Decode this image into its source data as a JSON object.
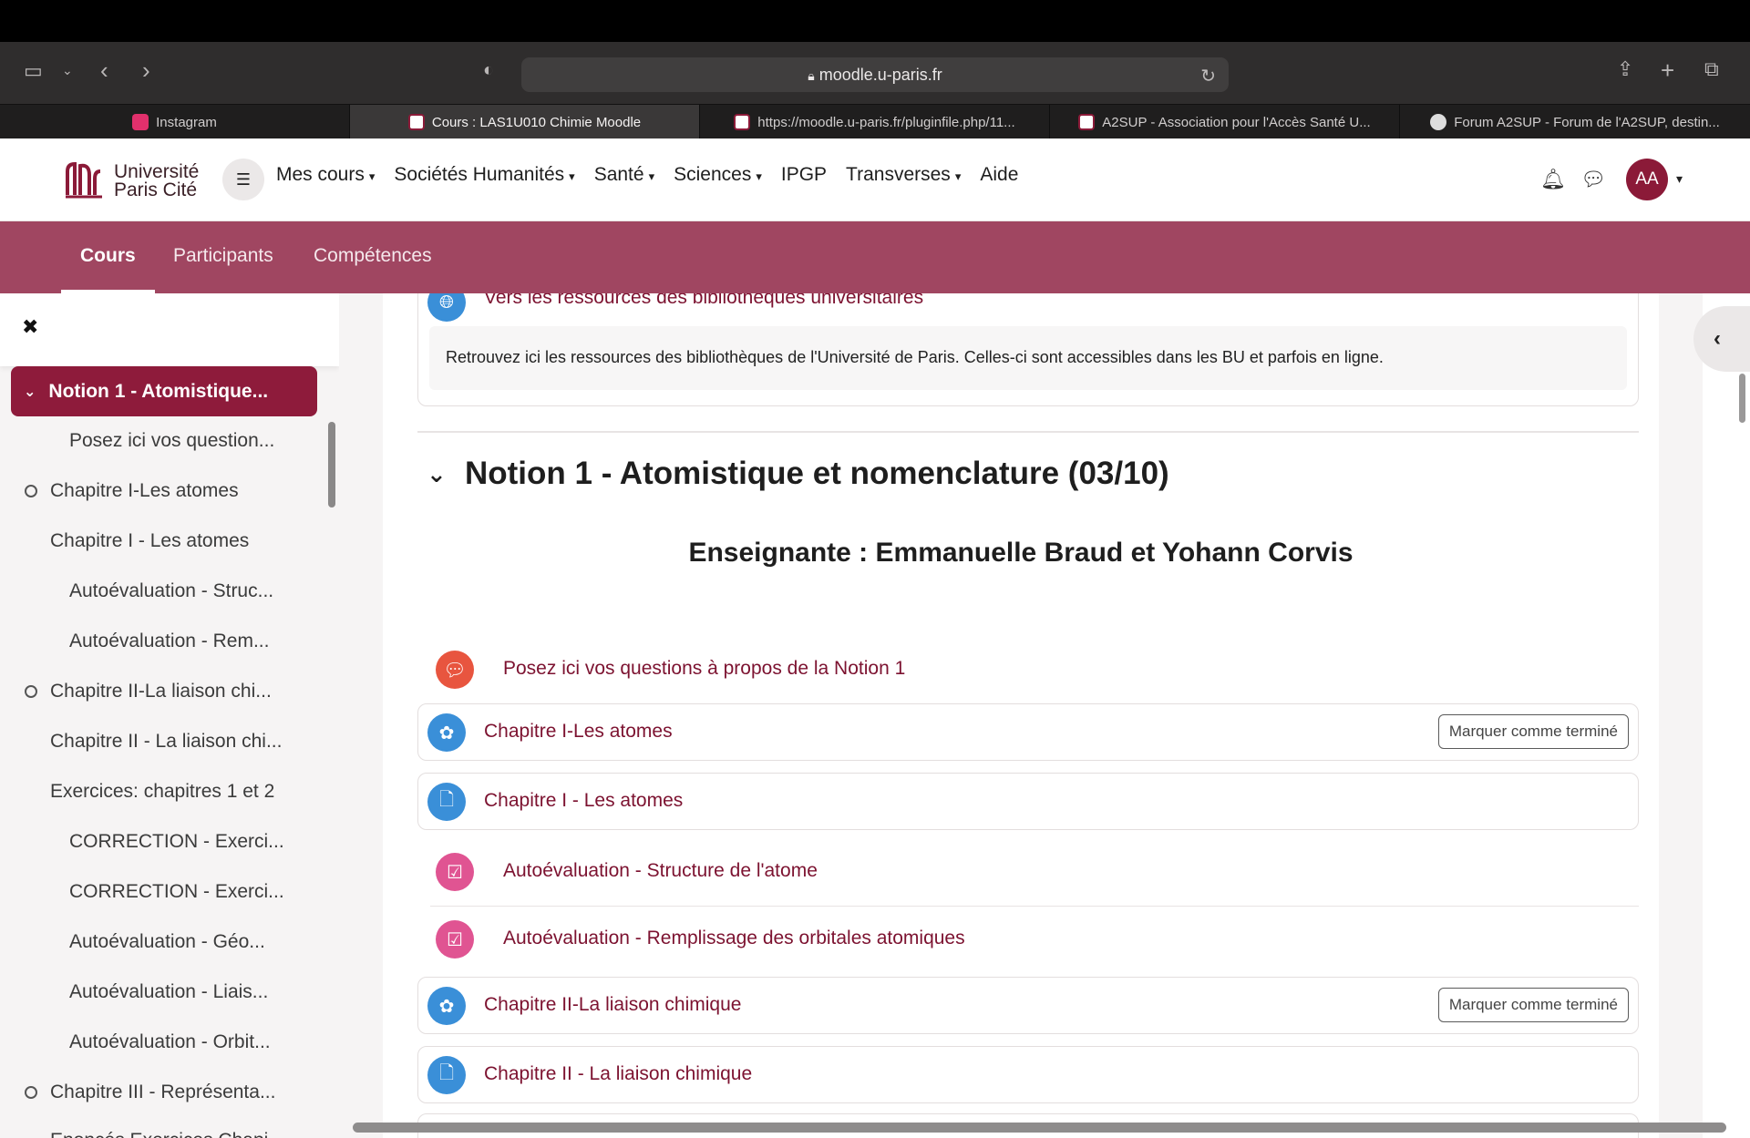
{
  "browser": {
    "address": "moodle.u-paris.fr",
    "tabs": [
      {
        "label": "Instagram",
        "color": "#e1306c"
      },
      {
        "label": "Cours : LAS1U010 Chimie Moodle",
        "color": "#8b1a38"
      },
      {
        "label": "https://moodle.u-paris.fr/pluginfile.php/11...",
        "color": "#8b1a38"
      },
      {
        "label": "A2SUP - Association pour l'Accès Santé U...",
        "color": "#8b1a38"
      },
      {
        "label": "Forum A2SUP - Forum de l'A2SUP, destin...",
        "color": "#888888"
      }
    ]
  },
  "header": {
    "logo_line1": "Université",
    "logo_line2": "Paris Cité",
    "nav": [
      {
        "label": "Mes cours",
        "dropdown": true
      },
      {
        "label": "Sociétés Humanités",
        "dropdown": true
      },
      {
        "label": "Santé",
        "dropdown": true
      },
      {
        "label": "Sciences",
        "dropdown": true
      },
      {
        "label": "IPGP",
        "dropdown": false
      },
      {
        "label": "Transverses",
        "dropdown": true
      },
      {
        "label": "Aide",
        "dropdown": false
      }
    ],
    "avatar_initials": "AA"
  },
  "secondary_nav": {
    "items": [
      "Cours",
      "Participants",
      "Compétences"
    ],
    "active": "Cours",
    "color": "#a04661"
  },
  "drawer": {
    "active_section": "Notion 1 - Atomistique...",
    "items": [
      {
        "label": "Posez ici vos question...",
        "indent": 2,
        "circle": false
      },
      {
        "label": "Chapitre I-Les atomes",
        "indent": 1,
        "circle": true
      },
      {
        "label": "Chapitre I - Les atomes",
        "indent": 1,
        "circle": false
      },
      {
        "label": "Autoévaluation - Struc...",
        "indent": 2,
        "circle": false
      },
      {
        "label": "Autoévaluation - Rem...",
        "indent": 2,
        "circle": false
      },
      {
        "label": "Chapitre II-La liaison chi...",
        "indent": 1,
        "circle": true
      },
      {
        "label": "Chapitre II - La liaison chi...",
        "indent": 1,
        "circle": false
      },
      {
        "label": "Exercices: chapitres 1 et 2",
        "indent": 1,
        "circle": false
      },
      {
        "label": "CORRECTION - Exerci...",
        "indent": 2,
        "circle": false
      },
      {
        "label": "CORRECTION - Exerci...",
        "indent": 2,
        "circle": false
      },
      {
        "label": "Autoévaluation - Géo...",
        "indent": 2,
        "circle": false
      },
      {
        "label": "Autoévaluation - Liais...",
        "indent": 2,
        "circle": false
      },
      {
        "label": "Autoévaluation - Orbit...",
        "indent": 2,
        "circle": false
      },
      {
        "label": "Chapitre III - Représenta...",
        "indent": 1,
        "circle": true
      },
      {
        "label": "Enoncés Exercices Chapi...",
        "indent": 1,
        "circle": false
      }
    ]
  },
  "main": {
    "library_link": "Vers les ressources des bibliothèques universitaires",
    "library_description": "Retrouvez ici les ressources des bibliothèques de l'Université de Paris. Celles-ci sont accessibles dans les BU et parfois en ligne.",
    "section_title": "Notion 1 - Atomistique et nomenclature (03/10)",
    "teacher_line": "Enseignante : Emmanuelle Braud et Yohann Corvis",
    "mark_done_label": "Marquer comme terminé",
    "activities": [
      {
        "label": "Posez ici vos questions à propos de la Notion 1",
        "type": "forum",
        "icon": "forum-icon",
        "carded": false,
        "mark_button": false
      },
      {
        "label": "Chapitre I-Les atomes",
        "type": "h5p",
        "icon": "interactive-content-icon",
        "carded": true,
        "mark_button": true
      },
      {
        "label": "Chapitre I - Les atomes",
        "type": "file",
        "icon": "file-icon",
        "carded": true,
        "mark_button": false
      },
      {
        "label": "Autoévaluation - Structure de l'atome",
        "type": "quiz",
        "icon": "quiz-icon",
        "carded": false,
        "mark_button": false
      },
      {
        "label": "Autoévaluation - Remplissage des orbitales atomiques",
        "type": "quiz",
        "icon": "quiz-icon",
        "carded": false,
        "mark_button": false
      },
      {
        "label": "Chapitre II-La liaison chimique",
        "type": "h5p",
        "icon": "interactive-content-icon",
        "carded": true,
        "mark_button": true
      },
      {
        "label": "Chapitre II - La liaison chimique",
        "type": "file",
        "icon": "file-icon",
        "carded": true,
        "mark_button": false
      }
    ],
    "colors": {
      "link": "#7c1230",
      "forum": "#e8553f",
      "quiz": "#e05492",
      "file": "#3a8fd8"
    }
  }
}
